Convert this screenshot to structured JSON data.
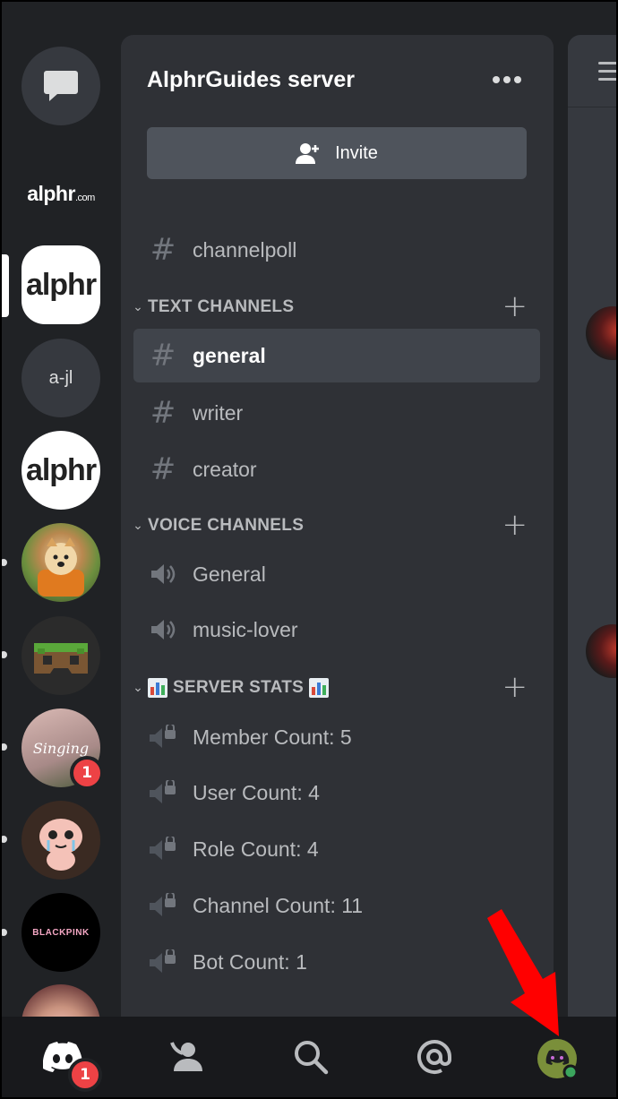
{
  "server": {
    "name": "AlphrGuides server",
    "invite_label": "Invite"
  },
  "rail": {
    "items": [
      {
        "name": "direct-messages",
        "icon": "chat-bubble-icon"
      },
      {
        "name": "alphr-com",
        "label": "alphr.com"
      },
      {
        "name": "alphr-selected",
        "label": "alphr",
        "selected": true
      },
      {
        "name": "a-jl",
        "label": "a-jl"
      },
      {
        "name": "alphr-2",
        "label": "alphr"
      },
      {
        "name": "shiba-server"
      },
      {
        "name": "minecraft-server"
      },
      {
        "name": "singing-server",
        "label": "Singing",
        "badge": "1"
      },
      {
        "name": "isaac-server"
      },
      {
        "name": "blackpink-server",
        "label": "BLACKPINK"
      },
      {
        "name": "partial-server"
      }
    ]
  },
  "channels": {
    "top": {
      "name": "channelpoll",
      "icon": "hash-icon"
    },
    "text_category": "TEXT CHANNELS",
    "text": [
      {
        "name": "general",
        "active": true
      },
      {
        "name": "writer"
      },
      {
        "name": "creator"
      }
    ],
    "voice_category": "VOICE CHANNELS",
    "voice": [
      {
        "name": "General"
      },
      {
        "name": "music-lover"
      }
    ],
    "stats_category": "SERVER STATS",
    "stats": [
      {
        "name": "Member Count: 5"
      },
      {
        "name": "User Count: 4"
      },
      {
        "name": "Role Count: 4"
      },
      {
        "name": "Channel Count: 11"
      },
      {
        "name": "Bot Count: 1"
      }
    ]
  },
  "nav": {
    "home_badge": "1",
    "items": [
      "home-icon",
      "friends-icon",
      "search-icon",
      "mentions-icon",
      "profile-avatar"
    ]
  },
  "colors": {
    "background": "#202225",
    "panel": "#2f3136",
    "chat": "#36393f",
    "nav": "#18191c",
    "badge": "#ed4245",
    "online": "#3ba55d",
    "arrow": "#ff0000"
  }
}
